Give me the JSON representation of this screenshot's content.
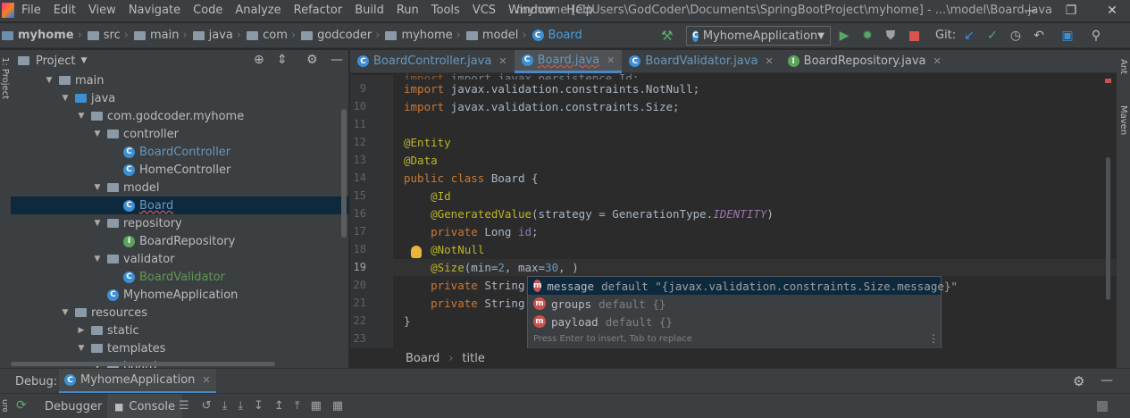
{
  "menu": {
    "items": [
      "File",
      "Edit",
      "View",
      "Navigate",
      "Code",
      "Analyze",
      "Refactor",
      "Build",
      "Run",
      "Tools",
      "VCS",
      "Window",
      "Help"
    ],
    "window_title": "myhome [C:\\Users\\GodCoder\\Documents\\SpringBootProject\\myhome] - ...\\model\\Board.java"
  },
  "breadcrumbs": [
    "myhome",
    "src",
    "main",
    "java",
    "com",
    "godcoder",
    "myhome",
    "model",
    "Board"
  ],
  "toolbar": {
    "run_config": "MyhomeApplication",
    "git_label": "Git:"
  },
  "project": {
    "title": "Project",
    "tree": [
      {
        "label": "main",
        "kind": "folder",
        "depth": 0,
        "expanded": true
      },
      {
        "label": "java",
        "kind": "folder-blue",
        "depth": 1,
        "expanded": true
      },
      {
        "label": "com.godcoder.myhome",
        "kind": "package",
        "depth": 2,
        "expanded": true
      },
      {
        "label": "controller",
        "kind": "package",
        "depth": 3,
        "expanded": true
      },
      {
        "label": "BoardController",
        "kind": "class-modified",
        "depth": 4
      },
      {
        "label": "HomeController",
        "kind": "class",
        "depth": 4
      },
      {
        "label": "model",
        "kind": "package",
        "depth": 3,
        "expanded": true
      },
      {
        "label": "Board",
        "kind": "class-modified",
        "depth": 4,
        "selected": true
      },
      {
        "label": "repository",
        "kind": "package",
        "depth": 3,
        "expanded": true
      },
      {
        "label": "BoardRepository",
        "kind": "interface",
        "depth": 4
      },
      {
        "label": "validator",
        "kind": "package",
        "depth": 3,
        "expanded": true
      },
      {
        "label": "BoardValidator",
        "kind": "class-new",
        "depth": 4
      },
      {
        "label": "MyhomeApplication",
        "kind": "class",
        "depth": 3
      },
      {
        "label": "resources",
        "kind": "folder",
        "depth": 1,
        "expanded": true
      },
      {
        "label": "static",
        "kind": "folder",
        "depth": 2,
        "expanded": false
      },
      {
        "label": "templates",
        "kind": "folder",
        "depth": 2,
        "expanded": true
      },
      {
        "label": "board",
        "kind": "folder",
        "depth": 3,
        "expanded": true
      }
    ]
  },
  "tabs": [
    {
      "label": "BoardController.java",
      "icon": "C",
      "active": false
    },
    {
      "label": "Board.java",
      "icon": "C",
      "active": true
    },
    {
      "label": "BoardValidator.java",
      "icon": "C",
      "active": false
    },
    {
      "label": "BoardRepository.java",
      "icon": "I",
      "active": false
    }
  ],
  "editor": {
    "lines": [
      {
        "n": "9",
        "code": "import javax.validation.constraints.NotNull;"
      },
      {
        "n": "10",
        "code": "import javax.validation.constraints.Size;"
      },
      {
        "n": "11",
        "code": ""
      },
      {
        "n": "12",
        "code": "@Entity"
      },
      {
        "n": "13",
        "code": "@Data"
      },
      {
        "n": "14",
        "code": "public class Board {"
      },
      {
        "n": "15",
        "code": "    @Id"
      },
      {
        "n": "16",
        "code": "    @GeneratedValue(strategy = GenerationType.IDENTITY)"
      },
      {
        "n": "17",
        "code": "    private Long id;"
      },
      {
        "n": "18",
        "code": "    @NotNull"
      },
      {
        "n": "19",
        "code": "    @Size(min=2, max=30, )"
      },
      {
        "n": "20",
        "code": "    private String ti"
      },
      {
        "n": "21",
        "code": "    private String co"
      },
      {
        "n": "22",
        "code": "}"
      },
      {
        "n": "23",
        "code": ""
      }
    ],
    "top_fragment": "import javax.persistence.Id;",
    "breadcrumb": [
      "Board",
      "title"
    ]
  },
  "completion": {
    "items": [
      {
        "name": "message",
        "default": "default \"{javax.validation.constraints.Size.message}\"",
        "selected": true
      },
      {
        "name": "groups",
        "default": "default {}",
        "selected": false
      },
      {
        "name": "payload",
        "default": "default {}",
        "selected": false
      }
    ],
    "hint": "Press Enter to insert, Tab to replace"
  },
  "debug": {
    "label": "Debug:",
    "session": "MyhomeApplication",
    "tabs": [
      "Debugger",
      "Console"
    ]
  },
  "side": {
    "left_label": "1: Project",
    "right_labels": [
      "Ant",
      "Maven"
    ],
    "bottom_left_label": "ure"
  },
  "colors": {
    "accent": "#4a88c7",
    "selection": "#0d293e",
    "run_green": "#59a869",
    "stop_red": "#d9534f"
  }
}
